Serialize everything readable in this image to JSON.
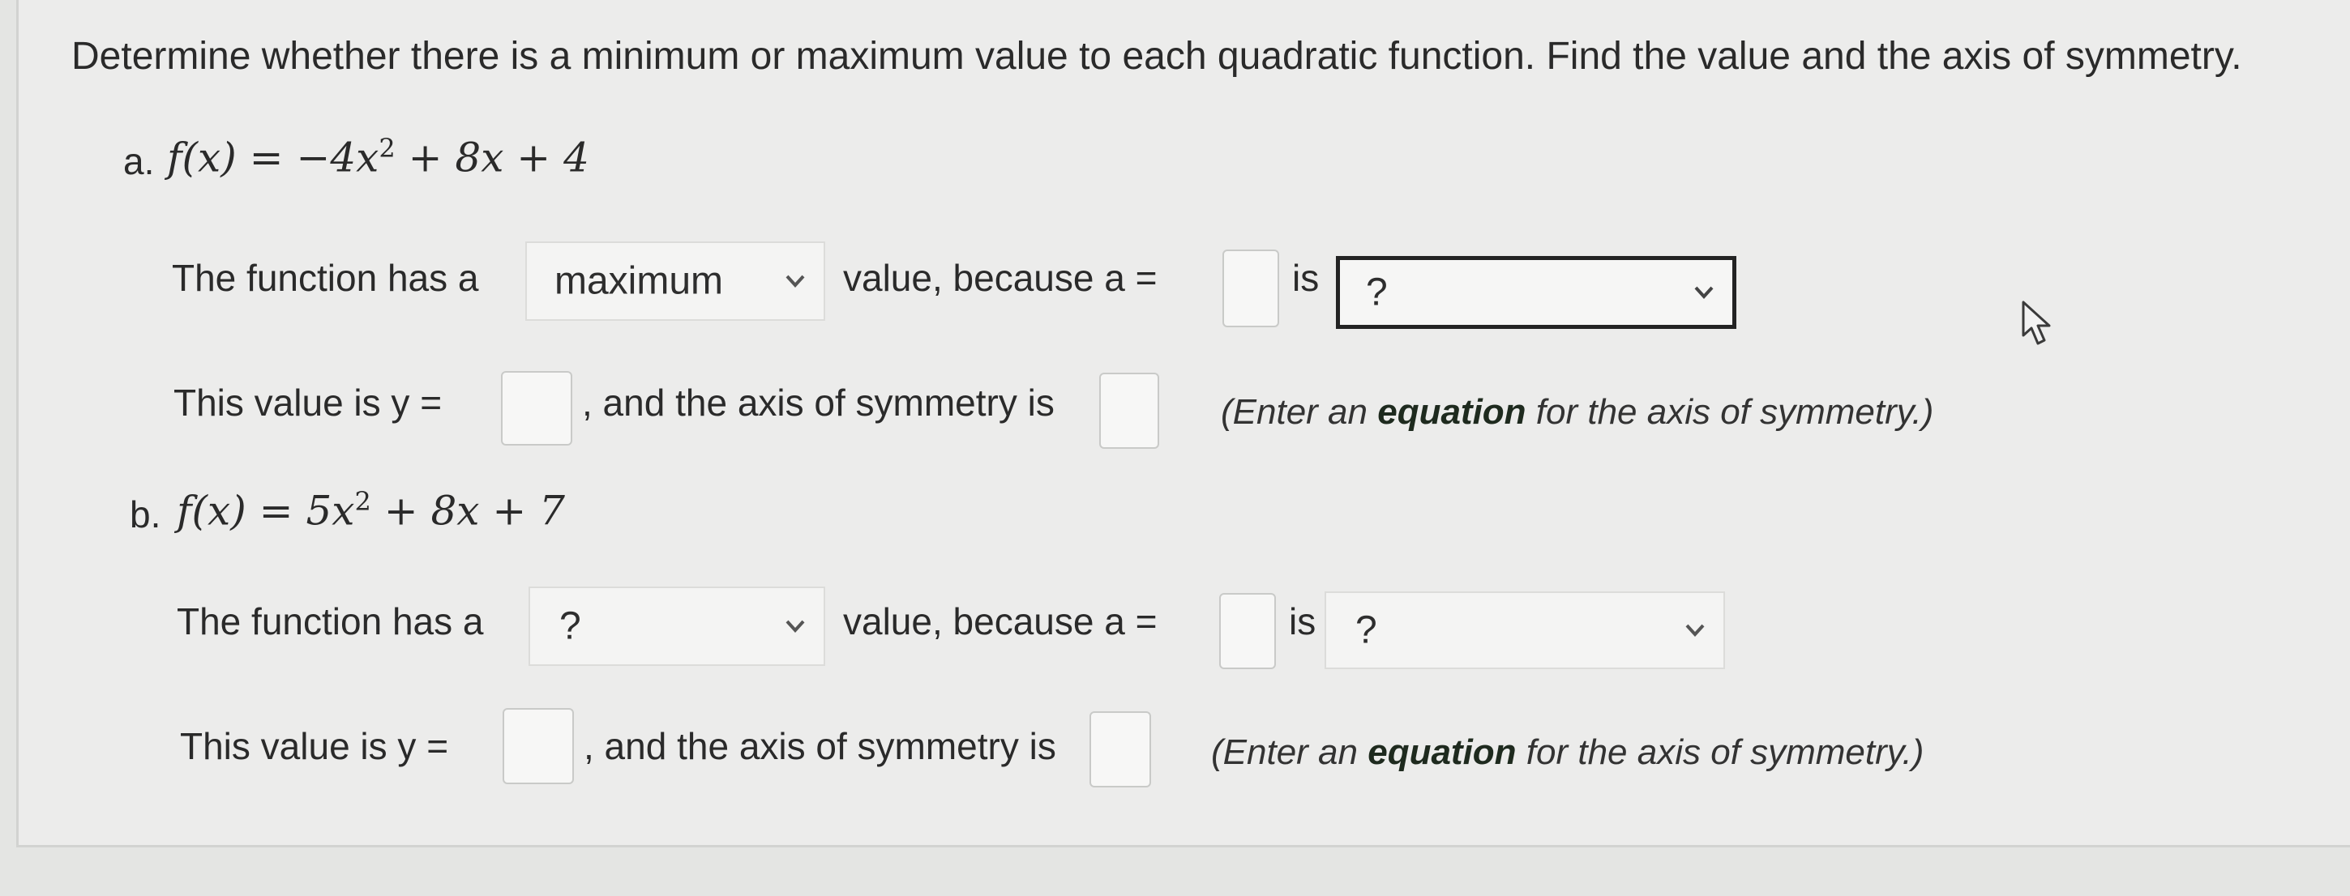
{
  "instructions": "Determine whether there is a minimum or maximum value to each quadratic function. Find the value and the axis of symmetry.",
  "parts": [
    {
      "label": "a.",
      "function": {
        "lhs": "f(x)",
        "eq": "=",
        "lead": "−4x",
        "exp": "2",
        "rest": " + 8x + 4"
      },
      "sentence1_prefix": "The function has a",
      "value_type_selected": "maximum",
      "sentence1_mid": "value, because a =",
      "is_label": "is",
      "sign_selected": "?",
      "sentence2_prefix": "This value is y =",
      "sentence2_mid": ", and the axis of symmetry is",
      "hint_pre": "(Enter an ",
      "hint_bold": "equation",
      "hint_post": " for the axis of symmetry.)"
    },
    {
      "label": "b.",
      "function": {
        "lhs": "f(x)",
        "eq": "=",
        "lead": "5x",
        "exp": "2",
        "rest": " + 8x + 7"
      },
      "sentence1_prefix": "The function has a",
      "value_type_selected": "?",
      "sentence1_mid": "value, because a =",
      "is_label": "is",
      "sign_selected": "?",
      "sentence2_prefix": "This value is y =",
      "sentence2_mid": ", and the axis of symmetry is",
      "hint_pre": "(Enter an ",
      "hint_bold": "equation",
      "hint_post": " for the axis of symmetry.)"
    }
  ],
  "icons": {
    "dropdown": "chevron-down-icon",
    "cursor": "mouse-pointer-icon"
  },
  "colors": {
    "focus_border": "#232323",
    "hint_bold": "#1e2a1e"
  }
}
